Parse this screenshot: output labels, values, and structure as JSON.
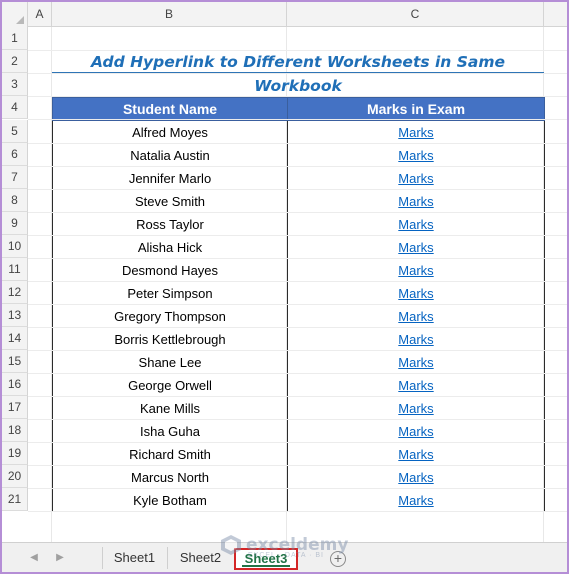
{
  "columns": [
    "A",
    "B",
    "C"
  ],
  "rows": [
    "1",
    "2",
    "3",
    "4",
    "5",
    "6",
    "7",
    "8",
    "9",
    "10",
    "11",
    "12",
    "13",
    "14",
    "15",
    "16",
    "17",
    "18",
    "19",
    "20",
    "21"
  ],
  "title": "Add Hyperlink to Different Worksheets in Same Workbook",
  "table": {
    "headers": [
      "Student Name",
      "Marks in Exam"
    ],
    "rows": [
      {
        "name": "Alfred Moyes",
        "link": "Marks"
      },
      {
        "name": "Natalia Austin",
        "link": "Marks"
      },
      {
        "name": "Jennifer Marlo",
        "link": "Marks"
      },
      {
        "name": "Steve Smith",
        "link": "Marks"
      },
      {
        "name": "Ross Taylor",
        "link": "Marks"
      },
      {
        "name": "Alisha Hick",
        "link": "Marks"
      },
      {
        "name": "Desmond Hayes",
        "link": "Marks"
      },
      {
        "name": "Peter Simpson",
        "link": "Marks"
      },
      {
        "name": "Gregory Thompson",
        "link": "Marks"
      },
      {
        "name": "Borris Kettlebrough",
        "link": "Marks"
      },
      {
        "name": "Shane Lee",
        "link": "Marks"
      },
      {
        "name": "George Orwell",
        "link": "Marks"
      },
      {
        "name": "Kane Mills",
        "link": "Marks"
      },
      {
        "name": "Isha Guha",
        "link": "Marks"
      },
      {
        "name": "Richard Smith",
        "link": "Marks"
      },
      {
        "name": "Marcus North",
        "link": "Marks"
      },
      {
        "name": "Kyle Botham",
        "link": "Marks"
      }
    ]
  },
  "sheet_tabs": [
    "Sheet1",
    "Sheet2",
    "Sheet3"
  ],
  "active_tab": "Sheet3",
  "watermark": {
    "brand": "exceldemy",
    "tagline": "EXCEL · DATA · BI"
  },
  "colors": {
    "header_fill": "#4472c4",
    "title": "#1f6fb7",
    "link": "#0563c1",
    "active_tab_border": "#d42626"
  }
}
